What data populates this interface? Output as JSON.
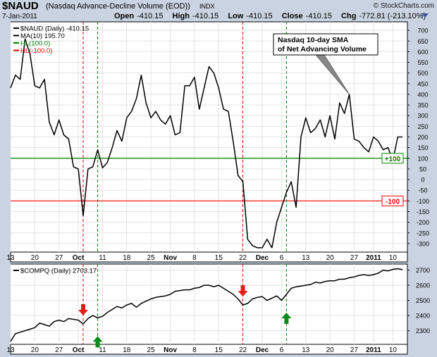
{
  "header": {
    "symbol": "$NAUD",
    "description": "(Nasdaq Advance-Decline Volume (EOD))",
    "exchange": "INDX",
    "brand": "© StockCharts.com",
    "date": "7-Jan-2011",
    "open_label": "Open",
    "open": "-410.15",
    "high_label": "High",
    "high": "-410.15",
    "low_label": "Low",
    "low": "-410.15",
    "close_label": "Close",
    "close": "-410.15",
    "chg_label": "Chg",
    "chg": "-772.81 (-213.10%)"
  },
  "chart_data": [
    {
      "type": "line",
      "legend": [
        "$NAUD (Daily) -410.15",
        "MA(10) 195.70",
        "HL(100.0)",
        "HL(-100.0)"
      ],
      "legend_colors": [
        "#000000",
        "#000000",
        "#008000",
        "#ff0000"
      ],
      "legend_placement": "top-left",
      "ylim": [
        -340,
        740
      ],
      "yticks": [
        700,
        650,
        600,
        550,
        500,
        450,
        400,
        350,
        300,
        250,
        200,
        150,
        100,
        50,
        0,
        -50,
        -100,
        -150,
        -200,
        -250,
        -300
      ],
      "xticks": [
        {
          "i": 0,
          "label": "13"
        },
        {
          "i": 5,
          "label": "20"
        },
        {
          "i": 10,
          "label": "27"
        },
        {
          "i": 14,
          "label": "Oct"
        },
        {
          "i": 19,
          "label": "11"
        },
        {
          "i": 24,
          "label": "18"
        },
        {
          "i": 29,
          "label": "25"
        },
        {
          "i": 33,
          "label": "Nov"
        },
        {
          "i": 38,
          "label": "8"
        },
        {
          "i": 43,
          "label": "15"
        },
        {
          "i": 48,
          "label": "22"
        },
        {
          "i": 52,
          "label": "Dec"
        },
        {
          "i": 56,
          "label": "6"
        },
        {
          "i": 61,
          "label": "13"
        },
        {
          "i": 66,
          "label": "20"
        },
        {
          "i": 71,
          "label": "27"
        },
        {
          "i": 75,
          "label": "2011"
        },
        {
          "i": 79,
          "label": "10"
        }
      ],
      "xlim": [
        0,
        82
      ],
      "series": [
        {
          "name": "MA(10)",
          "values": [
            430,
            490,
            470,
            660,
            590,
            440,
            430,
            470,
            270,
            210,
            280,
            210,
            190,
            60,
            50,
            -170,
            50,
            60,
            140,
            55,
            80,
            150,
            230,
            180,
            290,
            320,
            380,
            490,
            360,
            290,
            320,
            280,
            260,
            300,
            210,
            220,
            440,
            440,
            480,
            330,
            430,
            530,
            500,
            430,
            330,
            320,
            180,
            20,
            -10,
            -280,
            -310,
            -320,
            -320,
            -280,
            -320,
            -200,
            -130,
            -60,
            -10,
            -130,
            200,
            290,
            220,
            240,
            280,
            200,
            300,
            190,
            360,
            310,
            400,
            190,
            180,
            150,
            130,
            200,
            180,
            140,
            150,
            90,
            200,
            200
          ]
        }
      ],
      "hlines": [
        {
          "value": 100,
          "label": "+100",
          "color": "#008000"
        },
        {
          "value": -100,
          "label": "-100",
          "color": "#ff0000"
        }
      ],
      "vlines": [
        {
          "i": 15,
          "color": "#d00000"
        },
        {
          "i": 18,
          "color": "#008000"
        },
        {
          "i": 48,
          "color": "#d00000"
        },
        {
          "i": 57,
          "color": "#008000"
        }
      ],
      "annotation": "Nasdaq 10-day SMA of Net Advancing Volume",
      "annotation_target_i": 70,
      "grid": true
    },
    {
      "type": "line",
      "legend": [
        "$COMPQ (Daily) 2703.17"
      ],
      "legend_colors": [
        "#000000"
      ],
      "legend_placement": "top-left",
      "ylim": [
        2210,
        2740
      ],
      "yticks": [
        2700,
        2600,
        2500,
        2400,
        2300
      ],
      "xticks": [
        {
          "i": 0,
          "label": "13"
        },
        {
          "i": 5,
          "label": "20"
        },
        {
          "i": 10,
          "label": "27"
        },
        {
          "i": 14,
          "label": "Oct"
        },
        {
          "i": 19,
          "label": "11"
        },
        {
          "i": 24,
          "label": "18"
        },
        {
          "i": 29,
          "label": "25"
        },
        {
          "i": 33,
          "label": "Nov"
        },
        {
          "i": 38,
          "label": "8"
        },
        {
          "i": 43,
          "label": "15"
        },
        {
          "i": 48,
          "label": "22"
        },
        {
          "i": 52,
          "label": "Dec"
        },
        {
          "i": 56,
          "label": "6"
        },
        {
          "i": 61,
          "label": "13"
        },
        {
          "i": 66,
          "label": "20"
        },
        {
          "i": 71,
          "label": "27"
        },
        {
          "i": 75,
          "label": "2011"
        },
        {
          "i": 79,
          "label": "10"
        }
      ],
      "xlim": [
        0,
        82
      ],
      "series": [
        {
          "name": "$COMPQ",
          "values": [
            2230,
            2280,
            2290,
            2300,
            2310,
            2320,
            2350,
            2340,
            2330,
            2360,
            2370,
            2360,
            2380,
            2375,
            2370,
            2345,
            2380,
            2400,
            2385,
            2395,
            2420,
            2440,
            2460,
            2450,
            2470,
            2480,
            2455,
            2480,
            2495,
            2510,
            2520,
            2525,
            2530,
            2540,
            2560,
            2565,
            2570,
            2570,
            2580,
            2585,
            2600,
            2600,
            2590,
            2600,
            2580,
            2560,
            2540,
            2510,
            2470,
            2480,
            2510,
            2520,
            2525,
            2500,
            2515,
            2530,
            2500,
            2540,
            2580,
            2590,
            2595,
            2600,
            2605,
            2620,
            2615,
            2625,
            2630,
            2630,
            2640,
            2640,
            2650,
            2655,
            2665,
            2670,
            2665,
            2670,
            2680,
            2700,
            2695,
            2705,
            2710,
            2703
          ]
        }
      ],
      "markers": [
        {
          "i": 15,
          "dir": "down",
          "color": "#e31c1c"
        },
        {
          "i": 18,
          "dir": "up",
          "color": "#0c8a1a"
        },
        {
          "i": 48,
          "dir": "down",
          "color": "#e31c1c"
        },
        {
          "i": 57,
          "dir": "up",
          "color": "#0c8a1a"
        }
      ],
      "vlines": [
        {
          "i": 15,
          "color": "#d00000"
        },
        {
          "i": 18,
          "color": "#008000"
        },
        {
          "i": 48,
          "color": "#d00000"
        },
        {
          "i": 57,
          "color": "#008000"
        }
      ],
      "grid": true
    }
  ]
}
